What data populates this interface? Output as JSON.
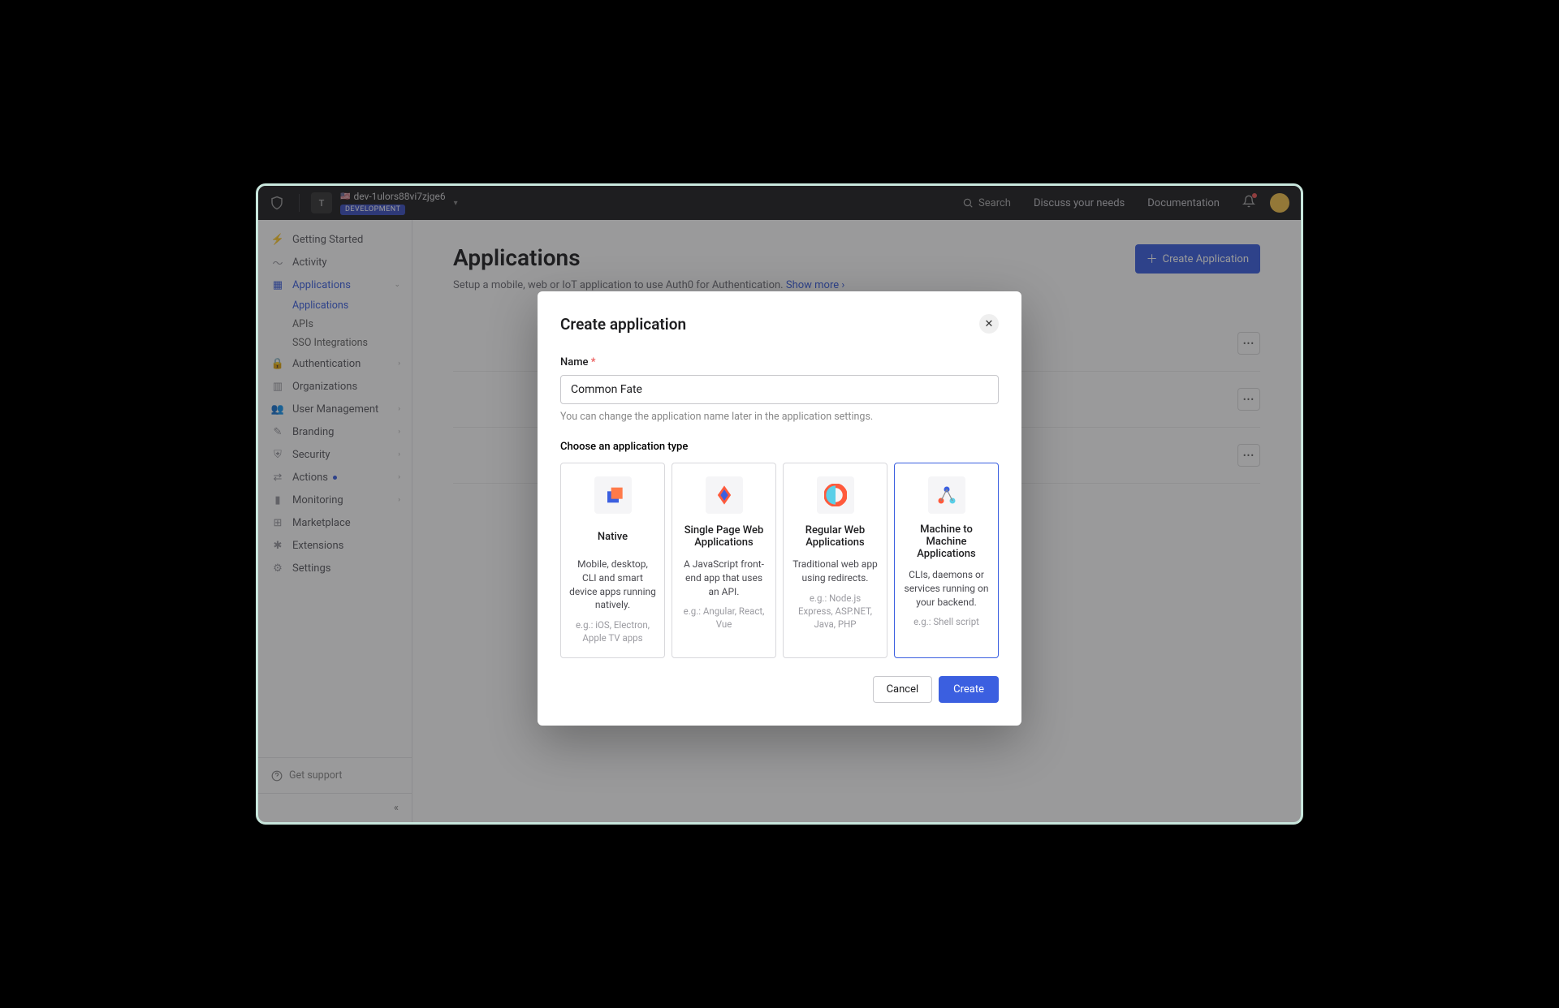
{
  "topbar": {
    "tenant_letter": "T",
    "tenant_name": "dev-1ulors88vi7zjge6",
    "tenant_badge": "DEVELOPMENT",
    "search": "Search",
    "discuss": "Discuss your needs",
    "docs": "Documentation"
  },
  "sidebar": {
    "items": [
      {
        "label": "Getting Started"
      },
      {
        "label": "Activity"
      },
      {
        "label": "Applications",
        "active": true,
        "sub": [
          {
            "label": "Applications",
            "active": true
          },
          {
            "label": "APIs"
          },
          {
            "label": "SSO Integrations"
          }
        ]
      },
      {
        "label": "Authentication",
        "expandable": true
      },
      {
        "label": "Organizations"
      },
      {
        "label": "User Management",
        "expandable": true
      },
      {
        "label": "Branding",
        "expandable": true
      },
      {
        "label": "Security",
        "expandable": true
      },
      {
        "label": "Actions",
        "dot": true,
        "expandable": true
      },
      {
        "label": "Monitoring",
        "expandable": true
      },
      {
        "label": "Marketplace"
      },
      {
        "label": "Extensions"
      },
      {
        "label": "Settings"
      }
    ],
    "support": "Get support"
  },
  "page": {
    "title": "Applications",
    "subtitle": "Setup a mobile, web or IoT application to use Auth0 for Authentication.",
    "show_more": "Show more",
    "create_btn": "Create Application"
  },
  "modal": {
    "title": "Create application",
    "name_label": "Name",
    "name_value": "Common Fate",
    "name_helper": "You can change the application name later in the application settings.",
    "type_label": "Choose an application type",
    "types": [
      {
        "title": "Native",
        "desc": "Mobile, desktop, CLI and smart device apps running natively.",
        "eg": "e.g.: iOS, Electron, Apple TV apps"
      },
      {
        "title": "Single Page Web Applications",
        "desc": "A JavaScript front-end app that uses an API.",
        "eg": "e.g.: Angular, React, Vue"
      },
      {
        "title": "Regular Web Applications",
        "desc": "Traditional web app using redirects.",
        "eg": "e.g.: Node.js Express, ASP.NET, Java, PHP"
      },
      {
        "title": "Machine to Machine Applications",
        "desc": "CLIs, daemons or services running on your backend.",
        "eg": "e.g.: Shell script",
        "selected": true
      }
    ],
    "cancel": "Cancel",
    "create": "Create"
  }
}
